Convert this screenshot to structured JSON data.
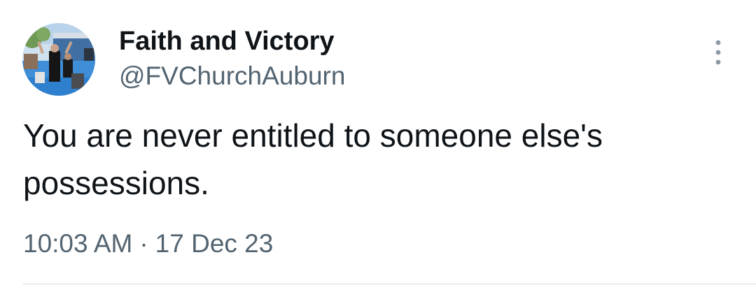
{
  "author": {
    "display_name": "Faith and Victory",
    "handle": "@FVChurchAuburn"
  },
  "tweet": {
    "text": "You are never entitled to someone else's possessions.",
    "time": "10:03 AM",
    "separator": "·",
    "date": "17 Dec 23"
  },
  "icons": {
    "more": "more-vertical-icon"
  },
  "colors": {
    "text": "#0f1419",
    "secondary": "#536471",
    "icon": "#8b98a5",
    "divider": "#cfd9de"
  }
}
